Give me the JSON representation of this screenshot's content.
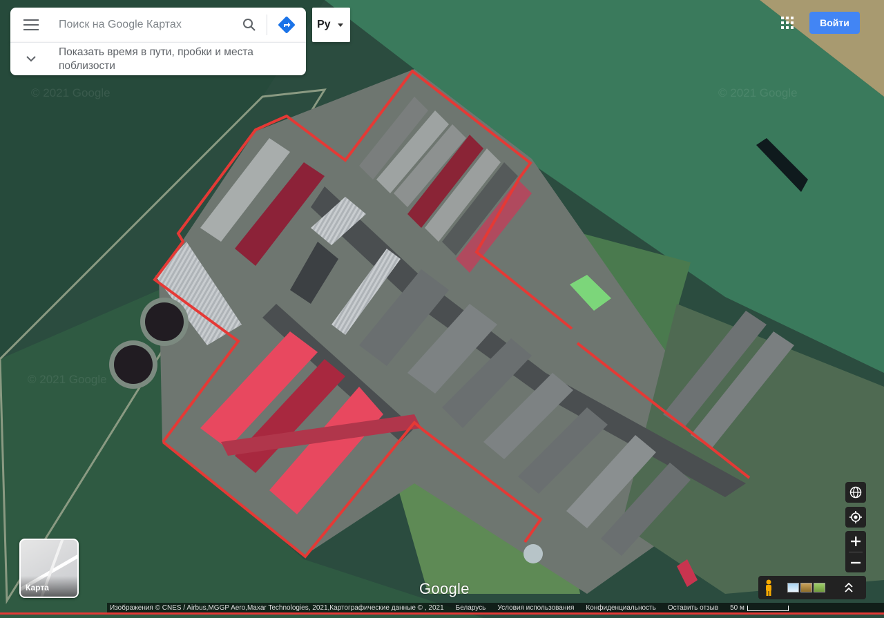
{
  "search": {
    "placeholder": "Поиск на Google Картах",
    "traffic_toggle": "Показать время в пути, пробки и места поблизости"
  },
  "language": {
    "label": "Ру"
  },
  "header": {
    "login_label": "Войти"
  },
  "layer_switch": {
    "label": "Карта"
  },
  "branding": {
    "logo": "Google"
  },
  "footer": {
    "imagery": "Изображения © CNES / Airbus,MGGP Aero,Maxar Technologies, 2021,Картографические данные © , 2021",
    "country": "Беларусь",
    "terms": "Условия использования",
    "privacy": "Конфиденциальность",
    "feedback": "Оставить отзыв",
    "scale": "50 м"
  },
  "watermarks": [
    "© 2021 Google",
    "© 2021 Google",
    "© 2021 Google"
  ],
  "colors": {
    "boundary": "#e53935",
    "accent": "#4285f4",
    "directions": "#1a73e8"
  },
  "icons": [
    "menu-icon",
    "search-icon",
    "directions-icon",
    "chevron-down-icon",
    "caret-down-icon",
    "apps-grid-icon",
    "globe-icon",
    "my-location-icon",
    "zoom-in-icon",
    "zoom-out-icon",
    "pegman-icon",
    "chevron-up-icon"
  ]
}
